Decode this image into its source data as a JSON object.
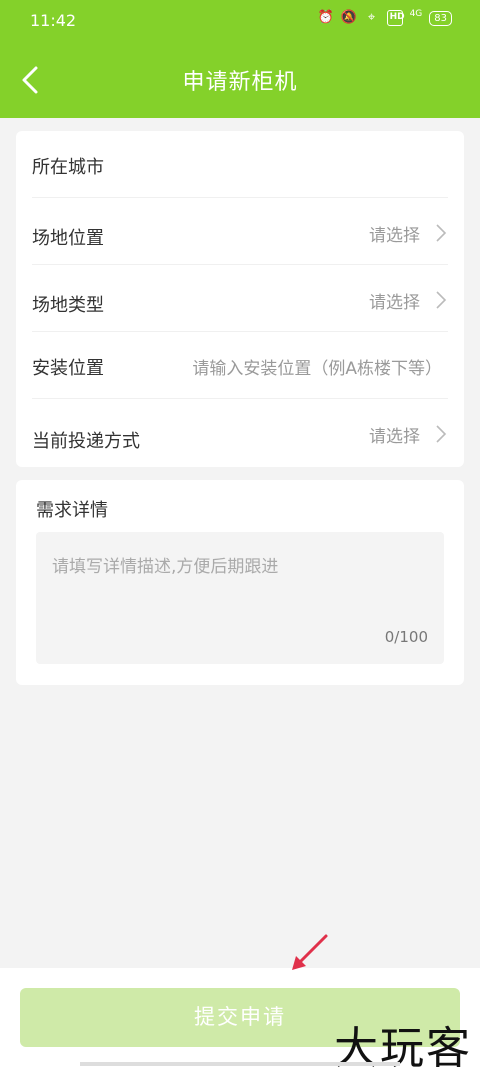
{
  "status_bar": {
    "time": "11:42",
    "icons": [
      "alarm-icon",
      "mute-icon",
      "location-icon",
      "hd-icon",
      "signal-icon",
      "battery-icon"
    ],
    "hd": "HD",
    "network": "4G",
    "battery": "83"
  },
  "header": {
    "title": "申请新柜机",
    "back_icon": "chevron-left-icon",
    "color": "#84d12a"
  },
  "form": {
    "rows": [
      {
        "label": "所在城市",
        "value": ""
      },
      {
        "label": "场地位置",
        "value": "请选择"
      },
      {
        "label": "场地类型",
        "value": "请选择"
      },
      {
        "label": "安装位置",
        "placeholder": "请输入安装位置（例A栋楼下等）"
      },
      {
        "label": "当前投递方式",
        "value": "请选择"
      }
    ]
  },
  "details": {
    "label": "需求详情",
    "placeholder": "请填写详情描述,方便后期跟进",
    "counter": "0/100"
  },
  "footer": {
    "submit_label": "提交申请",
    "submit_color": "#cfeaa8"
  },
  "watermark": "大玩客"
}
